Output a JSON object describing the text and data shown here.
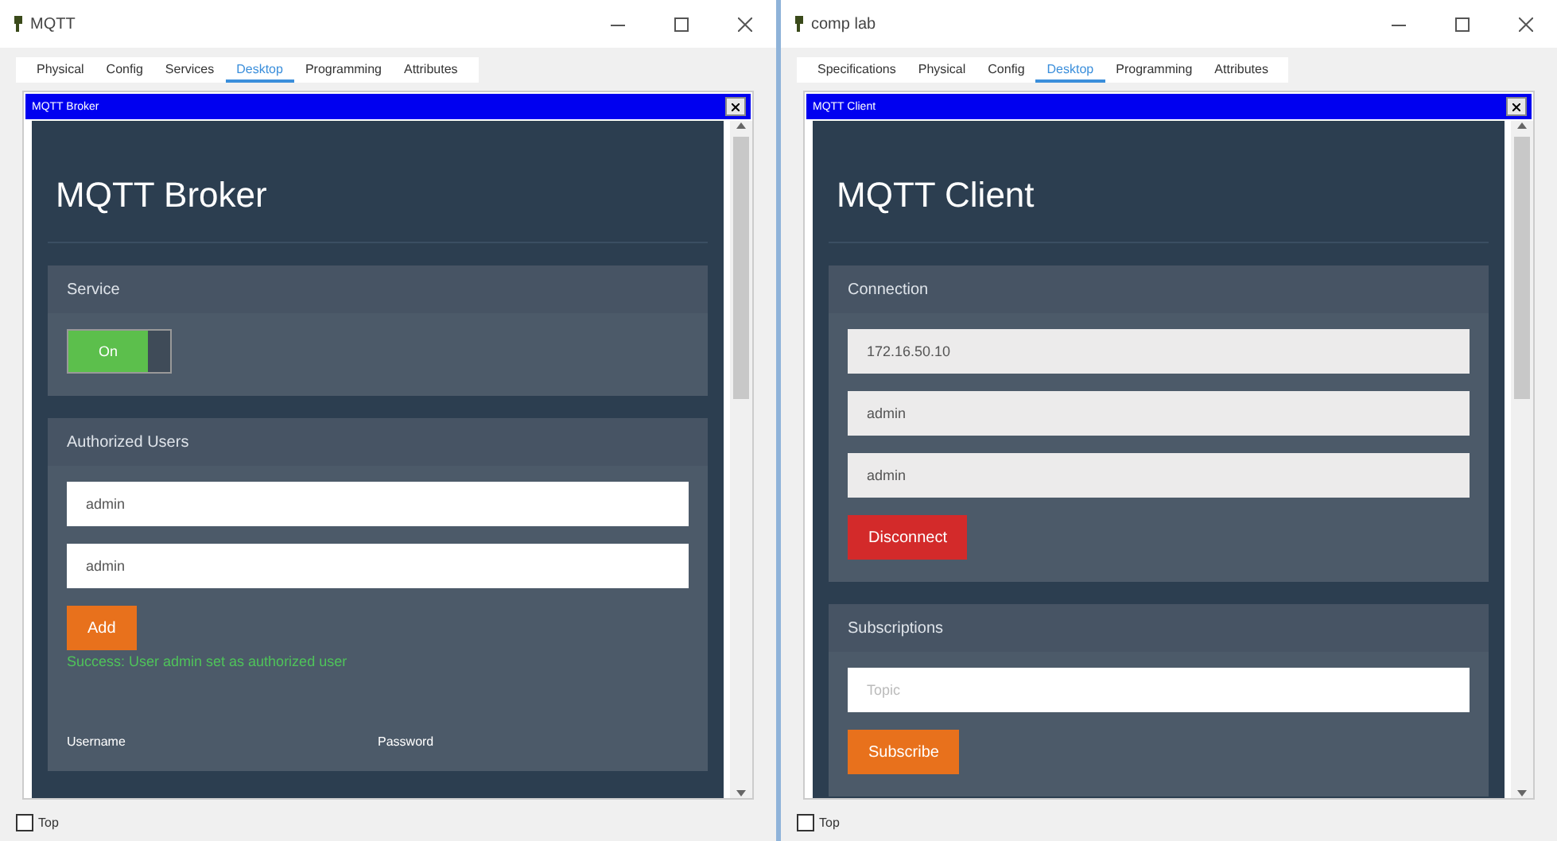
{
  "windows": [
    {
      "title": "MQTT",
      "tabs": [
        {
          "label": "Physical",
          "selected": false
        },
        {
          "label": "Config",
          "selected": false
        },
        {
          "label": "Services",
          "selected": false
        },
        {
          "label": "Desktop",
          "selected": true
        },
        {
          "label": "Programming",
          "selected": false
        },
        {
          "label": "Attributes",
          "selected": false
        }
      ],
      "app_title": "MQTT Broker",
      "heading": "MQTT Broker",
      "sections": [
        {
          "title": "Service",
          "items": [
            {
              "kind": "toggle",
              "label": "On",
              "on": true
            }
          ]
        },
        {
          "title": "Authorized Users",
          "items": [
            {
              "kind": "field",
              "value": "admin",
              "disabled": false
            },
            {
              "kind": "field",
              "value": "admin",
              "disabled": false
            },
            {
              "kind": "button",
              "label": "Add",
              "color": "#e8711c"
            },
            {
              "kind": "message",
              "text": "Success: User admin set as authorized user"
            },
            {
              "kind": "columns",
              "labels": [
                "Username",
                "Password"
              ]
            }
          ]
        }
      ],
      "top": {
        "label": "Top",
        "checked": false
      }
    },
    {
      "title": "comp lab",
      "tabs": [
        {
          "label": "Specifications",
          "selected": false
        },
        {
          "label": "Physical",
          "selected": false
        },
        {
          "label": "Config",
          "selected": false
        },
        {
          "label": "Desktop",
          "selected": true
        },
        {
          "label": "Programming",
          "selected": false
        },
        {
          "label": "Attributes",
          "selected": false
        }
      ],
      "app_title": "MQTT Client",
      "heading": "MQTT Client",
      "sections": [
        {
          "title": "Connection",
          "items": [
            {
              "kind": "field",
              "value": "172.16.50.10",
              "disabled": true
            },
            {
              "kind": "field",
              "value": "admin",
              "disabled": true
            },
            {
              "kind": "field",
              "value": "admin",
              "disabled": true
            },
            {
              "kind": "button",
              "label": "Disconnect",
              "color": "#d32a2a"
            }
          ]
        },
        {
          "title": "Subscriptions",
          "items": [
            {
              "kind": "field",
              "placeholder": "Topic",
              "disabled": false
            },
            {
              "kind": "button",
              "label": "Subscribe",
              "color": "#e8711c"
            }
          ]
        }
      ],
      "top": {
        "label": "Top",
        "checked": false
      }
    }
  ]
}
